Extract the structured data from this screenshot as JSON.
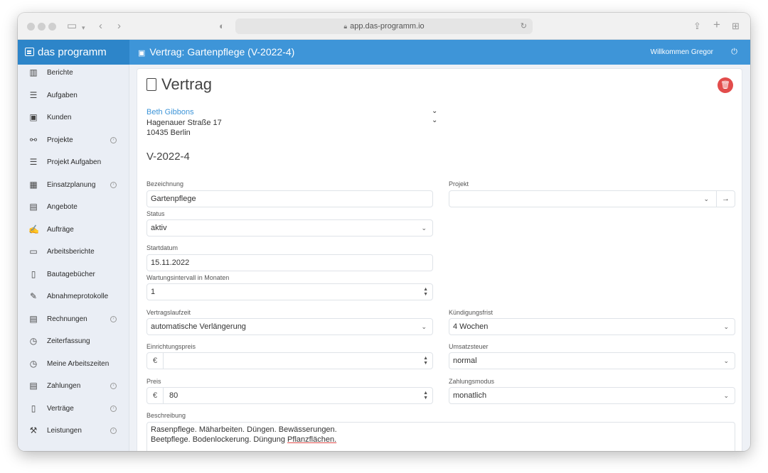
{
  "browser": {
    "url": "app.das-programm.io",
    "icons": {
      "sidebar_toggle": "sidebar-icon",
      "back": "chevron-left-icon",
      "forward": "chevron-right-icon",
      "share": "share-icon",
      "new_tab": "plus-icon",
      "tabs": "grid-icon"
    }
  },
  "app": {
    "brand": "das programm",
    "page_title": "Vertrag: Gartenpflege (V-2022-4)",
    "welcome": "Willkommen Gregor",
    "accent_color": "#3e95d8",
    "danger_color": "#e24c4b"
  },
  "sidebar": {
    "items": [
      {
        "label": "Berichte",
        "icon": "chart-icon",
        "glyph": "▥",
        "expandable": false
      },
      {
        "label": "Aufgaben",
        "icon": "checklist-icon",
        "glyph": "☰",
        "expandable": false
      },
      {
        "label": "Kunden",
        "icon": "contact-icon",
        "glyph": "▣",
        "expandable": false
      },
      {
        "label": "Projekte",
        "icon": "project-icon",
        "glyph": "⚯",
        "expandable": true
      },
      {
        "label": "Projekt Aufgaben",
        "icon": "checklist-icon",
        "glyph": "☰",
        "expandable": false
      },
      {
        "label": "Einsatzplanung",
        "icon": "calendar-icon",
        "glyph": "▦",
        "expandable": true
      },
      {
        "label": "Angebote",
        "icon": "calculator-icon",
        "glyph": "▤",
        "expandable": false
      },
      {
        "label": "Aufträge",
        "icon": "signature-icon",
        "glyph": "✍",
        "expandable": false
      },
      {
        "label": "Arbeitsberichte",
        "icon": "id-card-icon",
        "glyph": "▭",
        "expandable": false
      },
      {
        "label": "Bautagebücher",
        "icon": "book-icon",
        "glyph": "▯",
        "expandable": false
      },
      {
        "label": "Abnahmeprotokolle",
        "icon": "edit-document-icon",
        "glyph": "✎",
        "expandable": false
      },
      {
        "label": "Rechnungen",
        "icon": "invoice-icon",
        "glyph": "▤",
        "expandable": true
      },
      {
        "label": "Zeiterfassung",
        "icon": "clock-icon",
        "glyph": "◷",
        "expandable": false
      },
      {
        "label": "Meine Arbeitszeiten",
        "icon": "clock-icon",
        "glyph": "◷",
        "expandable": false
      },
      {
        "label": "Zahlungen",
        "icon": "cash-register-icon",
        "glyph": "▤",
        "expandable": true
      },
      {
        "label": "Verträge",
        "icon": "contract-icon",
        "glyph": "▯",
        "expandable": true
      },
      {
        "label": "Leistungen",
        "icon": "wrench-icon",
        "glyph": "⚒",
        "expandable": true
      }
    ]
  },
  "form": {
    "heading": "Vertrag",
    "customer": {
      "name": "Beth Gibbons",
      "street": "Hagenauer Straße 17",
      "city": "10435 Berlin"
    },
    "contract_number": "V-2022-4",
    "bezeichnung": {
      "label": "Bezeichnung",
      "value": "Gartenpflege"
    },
    "projekt": {
      "label": "Projekt",
      "value": ""
    },
    "status": {
      "label": "Status",
      "value": "aktiv"
    },
    "startdatum": {
      "label": "Startdatum",
      "value": "15.11.2022"
    },
    "wartungsintervall": {
      "label": "Wartungsintervall in Monaten",
      "value": "1"
    },
    "vertragslaufzeit": {
      "label": "Vertragslaufzeit",
      "value": "automatische Verlängerung"
    },
    "kuendigungsfrist": {
      "label": "Kündigungsfrist",
      "value": "4 Wochen"
    },
    "einrichtungspreis": {
      "label": "Einrichtungspreis",
      "currency": "€",
      "value": ""
    },
    "umsatzsteuer": {
      "label": "Umsatzsteuer",
      "value": "normal"
    },
    "preis": {
      "label": "Preis",
      "currency": "€",
      "value": "80"
    },
    "zahlungsmodus": {
      "label": "Zahlungsmodus",
      "value": "monatlich"
    },
    "beschreibung": {
      "label": "Beschreibung",
      "line1": "Rasenpflege. Mäharbeiten. Düngen. Bewässerungen.",
      "line2_prefix": "Beetpflege. Bodenlockerung. Düngung ",
      "line2_flagged": "Pflanzflächen."
    }
  }
}
